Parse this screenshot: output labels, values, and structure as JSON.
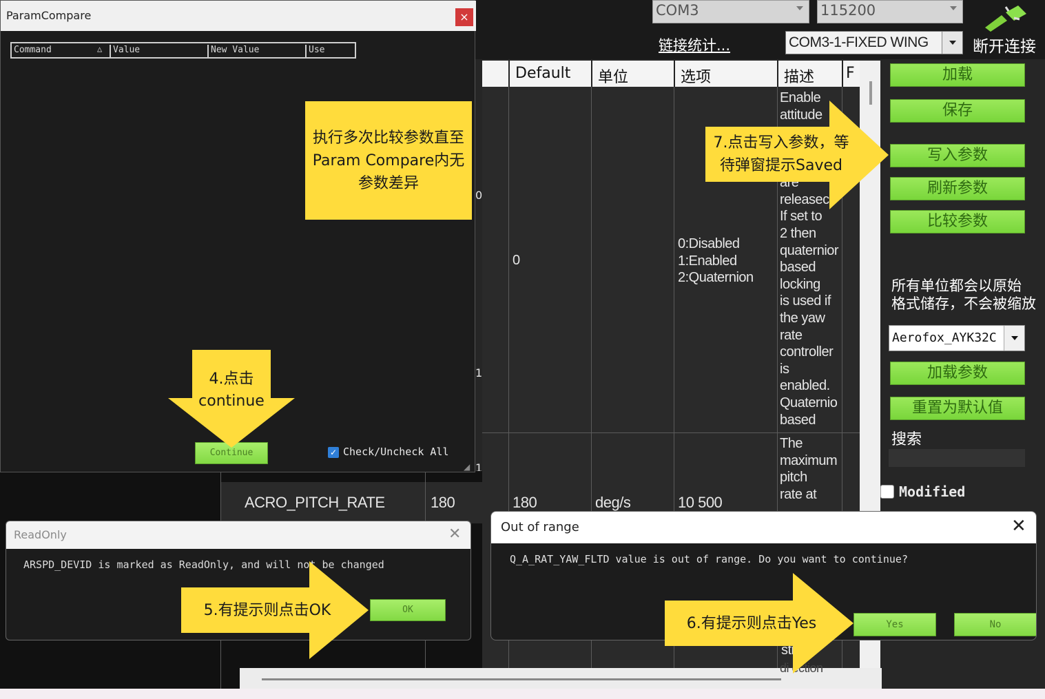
{
  "top_bar": {
    "port": "COM3",
    "baud": "115200",
    "link_stats": "链接统计...",
    "connection_profile": "COM3-1-FIXED WING",
    "disconnect_label": "断开连接"
  },
  "param_grid": {
    "columns": [
      "Default",
      "单位",
      "选项",
      "描述",
      "F"
    ],
    "left_gutter_digits": [
      "0",
      "1",
      "1"
    ],
    "rows": [
      {
        "default": "0",
        "unit": "",
        "options": [
          "0:Disabled",
          "1:Enabled",
          "2:Quaternion"
        ],
        "description": [
          "Enable",
          "attitude",
          "are",
          "releasec",
          "If set to",
          "2 then",
          "quaternior",
          "based",
          "locking",
          "is used if",
          "the yaw",
          "rate",
          "controller",
          "is",
          "enabled.",
          "Quaternio",
          "based"
        ]
      },
      {
        "name": "ACRO_PITCH_RATE",
        "value": "180",
        "default": "180",
        "unit": "deg/s",
        "options": "10 500",
        "description": [
          "The",
          "maximum",
          "pitch",
          "rate at"
        ]
      }
    ],
    "bottom_fragments": [
      "sti",
      "di ection"
    ]
  },
  "right_panel": {
    "buttons": [
      "加载",
      "保存",
      "写入参数",
      "刷新参数",
      "比较参数"
    ],
    "units_note_line1": "所有单位都会以原始",
    "units_note_line2": "格式储存，不会被缩放",
    "profile_select": "Aerofox_AYK32C",
    "buttons2": [
      "加载参数",
      "重置为默认值"
    ],
    "search_label": "搜索",
    "modified_label": "Modified"
  },
  "param_compare": {
    "title": "ParamCompare",
    "close": "×",
    "columns": [
      "Command",
      "Value",
      "New Value",
      "Use"
    ],
    "sort_indicator": "△",
    "continue_label": "Continue",
    "check_all_label": "Check/Uncheck All",
    "check_mark": "✓",
    "grip": "◢"
  },
  "readonly_dialog": {
    "title": "ReadOnly",
    "close": "✕",
    "message": "ARSPD_DEVID is marked as ReadOnly, and will not be changed",
    "ok_label": "OK"
  },
  "out_of_range_dialog": {
    "title": "Out of range",
    "close": "✕",
    "message": "Q_A_RAT_YAW_FLTD value is out of range. Do you want to continue?",
    "yes_label": "Yes",
    "no_label": "No"
  },
  "annotations": {
    "step_compare": "执行多次比较参数直至Param Compare内无参数差异",
    "step4": "4.点击continue",
    "step5": "5.有提示则点击OK",
    "step6": "6.有提示则点击Yes",
    "step7": "7.点击写入参数，等待弹窗提示Saved"
  },
  "colors": {
    "annotation_yellow": "#ffdc3c",
    "button_green": "#8be04c",
    "close_red": "#d23a3a"
  },
  "icons": [
    "disconnect-plug-icon",
    "dropdown-arrow-icon",
    "close-icon",
    "checkbox-checked-icon",
    "resize-grip-icon"
  ]
}
